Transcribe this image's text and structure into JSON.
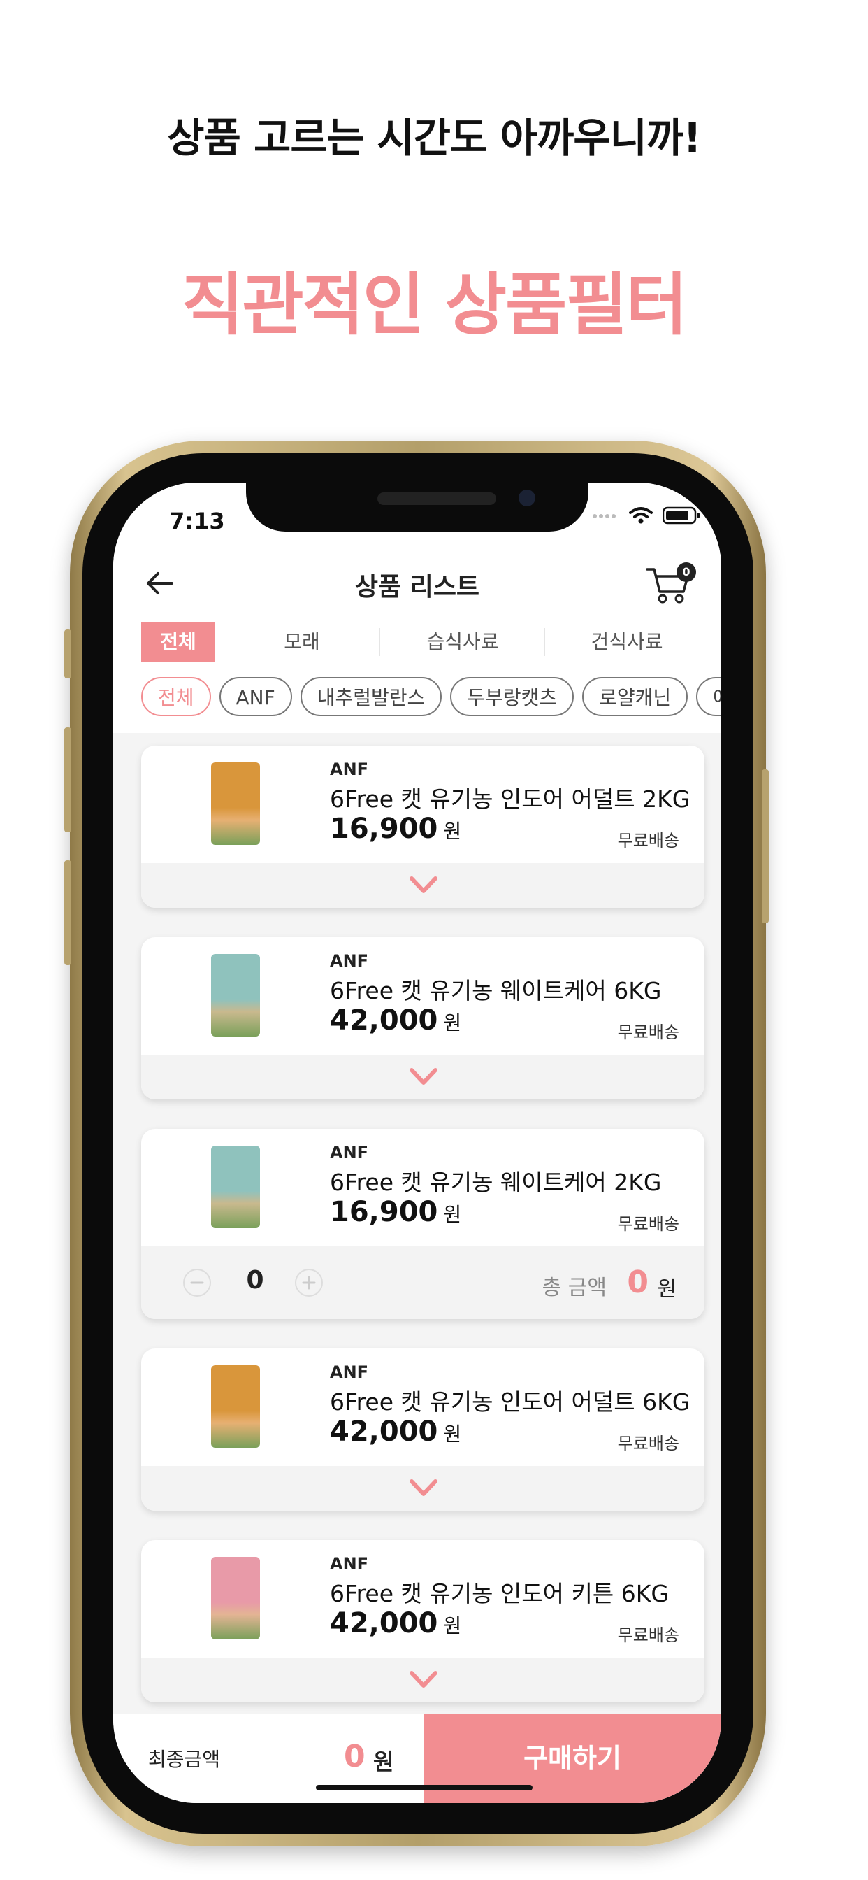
{
  "promo": {
    "line1": "상품 고르는 시간도 아까우니까!",
    "line2": "직관적인 상품필터"
  },
  "status": {
    "time": "7:13"
  },
  "header": {
    "title": "상품 리스트",
    "cart_count": "0"
  },
  "categories": [
    {
      "label": "전체",
      "active": true
    },
    {
      "label": "모래",
      "active": false
    },
    {
      "label": "습식사료",
      "active": false
    },
    {
      "label": "건식사료",
      "active": false
    }
  ],
  "brands": [
    {
      "label": "전체",
      "active": true
    },
    {
      "label": "ANF"
    },
    {
      "label": "내추럴발란스"
    },
    {
      "label": "두부랑캣츠"
    },
    {
      "label": "로얄캐닌"
    },
    {
      "label": "에"
    }
  ],
  "products": [
    {
      "brand": "ANF",
      "name": "6Free 캣 유기농 인도어 어덜트 2KG",
      "price": "16,900",
      "won": "원",
      "shipping": "무료배송",
      "pack_color": "#d9963b",
      "state": "collapsed"
    },
    {
      "brand": "ANF",
      "name": "6Free 캣 유기농 웨이트케어 6KG",
      "price": "42,000",
      "won": "원",
      "shipping": "무료배송",
      "pack_color": "#8fc2bd",
      "state": "collapsed"
    },
    {
      "brand": "ANF",
      "name": "6Free 캣 유기농 웨이트케어 2KG",
      "price": "16,900",
      "won": "원",
      "shipping": "무료배송",
      "pack_color": "#8fc2bd",
      "state": "expanded",
      "qty": "0",
      "total_label": "총 금액",
      "total": "0",
      "total_won": "원"
    },
    {
      "brand": "ANF",
      "name": "6Free 캣 유기농 인도어 어덜트 6KG",
      "price": "42,000",
      "won": "원",
      "shipping": "무료배송",
      "pack_color": "#d9963b",
      "state": "collapsed"
    },
    {
      "brand": "ANF",
      "name": "6Free 캣 유기농 인도어 키튼 6KG",
      "price": "42,000",
      "won": "원",
      "shipping": "무료배송",
      "pack_color": "#e89aa8",
      "state": "collapsed"
    }
  ],
  "footer": {
    "final_label": "최종금액",
    "final_amount": "0",
    "final_won": "원",
    "buy_label": "구매하기"
  },
  "colors": {
    "accent": "#f28d91"
  }
}
